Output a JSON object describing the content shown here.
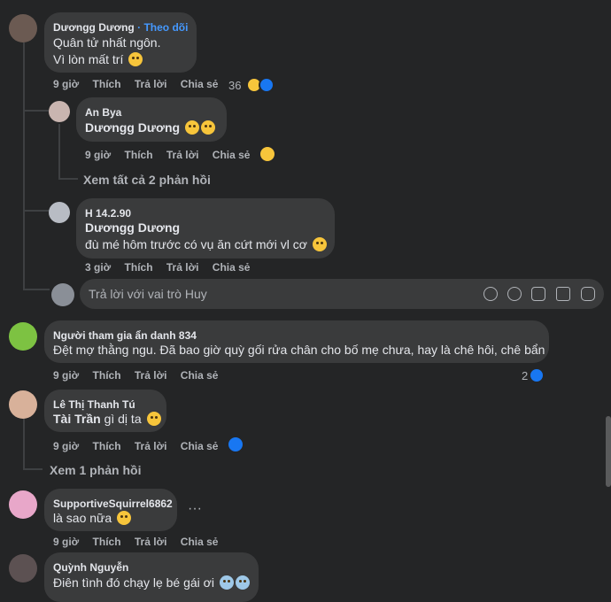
{
  "comments": [
    {
      "name": "Dươngg Dương",
      "follow": "· Theo dõi",
      "lines": [
        "Quân tử nhất ngôn.",
        "Vì lòn mất trí"
      ],
      "time": "9 giờ",
      "like": "Thích",
      "reply": "Trả lời",
      "share": "Chia sẻ",
      "reactions": "36"
    },
    {
      "name": "An Bya",
      "line1_bold": "Dươngg Dương",
      "time": "9 giờ",
      "like": "Thích",
      "reply": "Trả lời",
      "share": "Chia sẻ"
    },
    {
      "view_all": "Xem tất cả 2 phản hồi"
    },
    {
      "name": "H 14.2.90",
      "line1_bold": "Dươngg Dương",
      "line2": "đù mé hôm trước có vụ ăn cứt mới vl cơ",
      "time": "3 giờ",
      "like": "Thích",
      "reply": "Trả lời",
      "share": "Chia sẻ"
    },
    {
      "placeholder": "Trả lời với vai trò Huy"
    },
    {
      "name": "Người tham gia ẩn danh 834",
      "line": "Đệt mợ thằng ngu. Đã bao giờ quỳ gối rửa chân cho bố mẹ chưa, hay là chê hôi, chê bẩn",
      "time": "9 giờ",
      "like": "Thích",
      "reply": "Trả lời",
      "share": "Chia sẻ",
      "reactions": "2"
    },
    {
      "name": "Lê Thị Thanh Tú",
      "line_bold": "Tài Trần",
      "line_rest": "gì dị ta",
      "time": "9 giờ",
      "like": "Thích",
      "reply": "Trả lời",
      "share": "Chia sẻ"
    },
    {
      "view_one": "Xem 1 phản hồi"
    },
    {
      "name": "SupportiveSquirrel6862",
      "line": "là sao nữa",
      "more": "···",
      "time": "9 giờ",
      "like": "Thích",
      "reply": "Trả lời",
      "share": "Chia sẻ"
    },
    {
      "name": "Quỳnh Nguyễn",
      "line": "Điên tình đó chạy lẹ bé gái ơi"
    }
  ],
  "colors": {
    "background": "#242526",
    "bubble": "#3a3b3c",
    "accent": "#4599ff",
    "like": "#1877f2"
  }
}
